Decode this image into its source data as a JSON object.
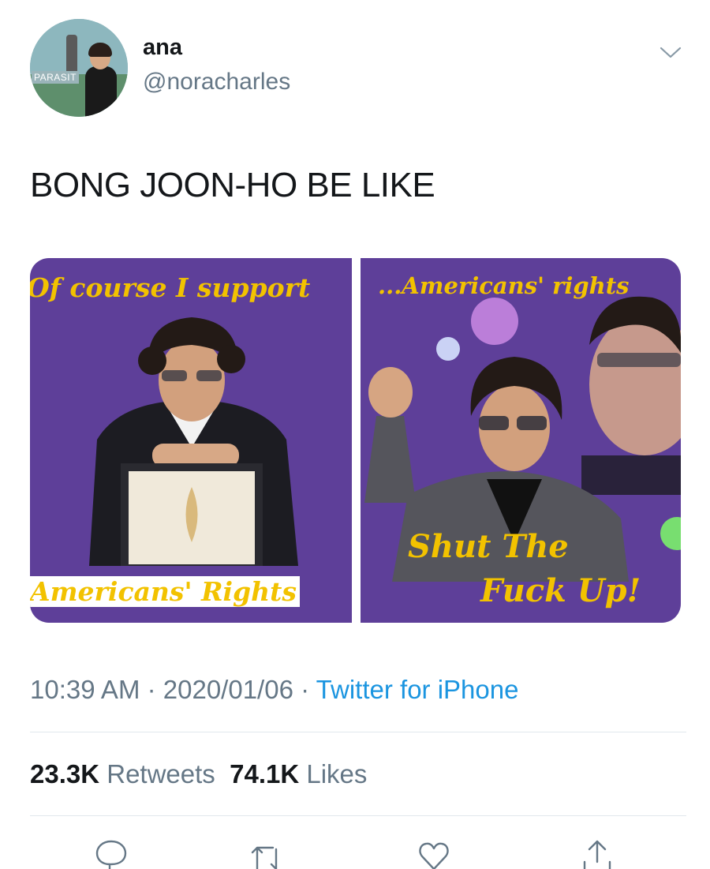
{
  "author": {
    "name": "ana",
    "handle": "@noracharles",
    "avatar_sign": "PARASIT"
  },
  "tweet": {
    "text": "BONG JOON-HO BE LIKE"
  },
  "media": {
    "left_panel": {
      "top_caption": "Of course I support",
      "bottom_caption": "Americans' Rights"
    },
    "right_panel": {
      "top_caption": "...Americans' rights",
      "bottom_caption_line1": "Shut The",
      "bottom_caption_line2": "Fuck Up!"
    },
    "background_color": "#5e3f99",
    "caption_color": "#f2c200"
  },
  "meta": {
    "time": "10:39 AM",
    "separator": " · ",
    "date": "2020/01/06",
    "source": "Twitter for iPhone"
  },
  "stats": {
    "retweets_count": "23.3K",
    "retweets_label": "Retweets",
    "likes_count": "74.1K",
    "likes_label": "Likes"
  },
  "actions": [
    "reply-icon",
    "retweet-icon",
    "like-icon",
    "share-icon"
  ],
  "colors": {
    "text": "#14171a",
    "secondary": "#657786",
    "link": "#1b95e0",
    "divider": "#e1e8ed"
  }
}
